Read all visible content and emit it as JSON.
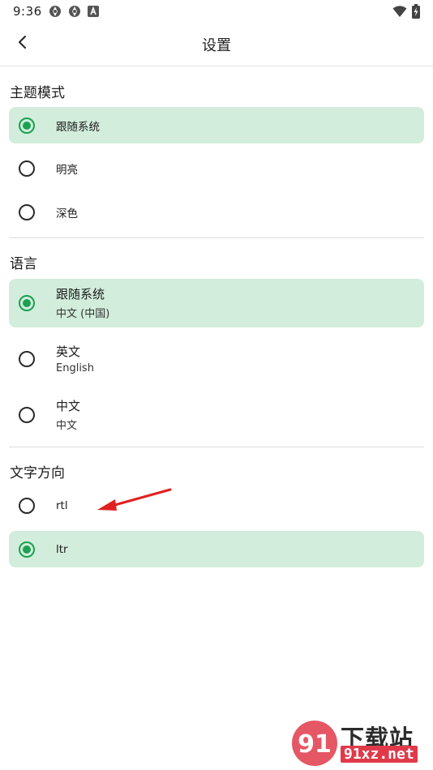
{
  "status_bar": {
    "time": "9:36",
    "left_icons": [
      "aperture-icon",
      "aperture-icon",
      "font-a-icon"
    ],
    "right_icons": [
      "wifi-icon",
      "battery-charging-icon"
    ]
  },
  "app_bar": {
    "title": "设置",
    "back_icon": "chevron-left-icon"
  },
  "sections": {
    "theme": {
      "header": "主题模式",
      "options": [
        {
          "label": "跟随系统",
          "selected": true
        },
        {
          "label": "明亮",
          "selected": false
        },
        {
          "label": "深色",
          "selected": false
        }
      ]
    },
    "language": {
      "header": "语言",
      "options": [
        {
          "label": "跟随系统",
          "sublabel": "中文 (中国)",
          "selected": true
        },
        {
          "label": "英文",
          "sublabel": "English",
          "selected": false
        },
        {
          "label": "中文",
          "sublabel": "中文",
          "selected": false
        }
      ]
    },
    "direction": {
      "header": "文字方向",
      "options": [
        {
          "label": "rtl",
          "selected": false
        },
        {
          "label": "ltr",
          "selected": true
        }
      ]
    }
  },
  "colors": {
    "accent": "#1aa152",
    "selected_bg": "#d2eddb",
    "annotation": "#e02020"
  },
  "watermark": {
    "title": "下载站",
    "url": "91xz.net",
    "logo": "91"
  }
}
